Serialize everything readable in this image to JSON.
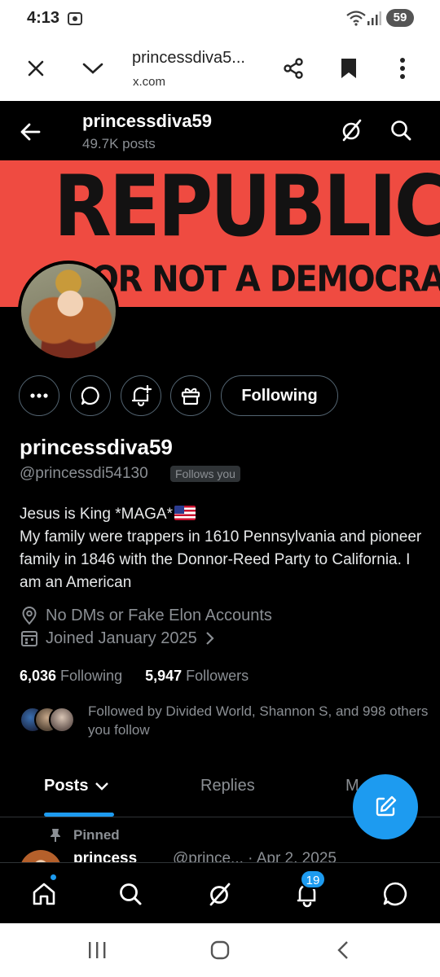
{
  "status_bar": {
    "time": "4:13",
    "battery": "59",
    "icons": [
      "screenshot-icon",
      "wifi-icon",
      "signal-icon",
      "battery-icon"
    ]
  },
  "browser": {
    "title": "princessdiva5...",
    "domain": "x.com",
    "icons": [
      "close-icon",
      "chevron-down-icon",
      "share-icon",
      "bookmark-icon",
      "more-vertical-icon"
    ]
  },
  "header": {
    "name": "princessdiva59",
    "posts_count": "49.7K posts"
  },
  "banner": {
    "headline": "REPUBLIC",
    "subline": "OR NOT A DEMOCRACY;",
    "color": "#ef4b41"
  },
  "profile": {
    "actions": [
      "more-icon",
      "message-icon",
      "notify-icon",
      "gift-icon"
    ],
    "following_label": "Following",
    "display_name": "princessdiva59",
    "handle": "@princessdi54130",
    "follows_you": "Follows you",
    "bio_line1": "Jesus is King *MAGA*",
    "bio_line2": "My family were trappers in 1610 Pennsylvania  and pioneer family in 1846 with the Donnor-Reed Party to California.  I am an American",
    "location": "No DMs or Fake Elon Accounts",
    "joined": "Joined January 2025",
    "following_count": "6,036",
    "following_label2": "Following",
    "followers_count": "5,947",
    "followers_label": "Followers",
    "followed_by": "Followed by Divided World, Shannon S, and 998 others you follow"
  },
  "tabs": {
    "posts": "Posts",
    "replies": "Replies",
    "media": "M"
  },
  "pinned_post": {
    "pinned_label": "Pinned",
    "name": "princess",
    "handle_date": "@prince... · Apr 2, 2025"
  },
  "bottom_nav": {
    "notifications_badge": "19",
    "accent": "#1d9bf0"
  }
}
